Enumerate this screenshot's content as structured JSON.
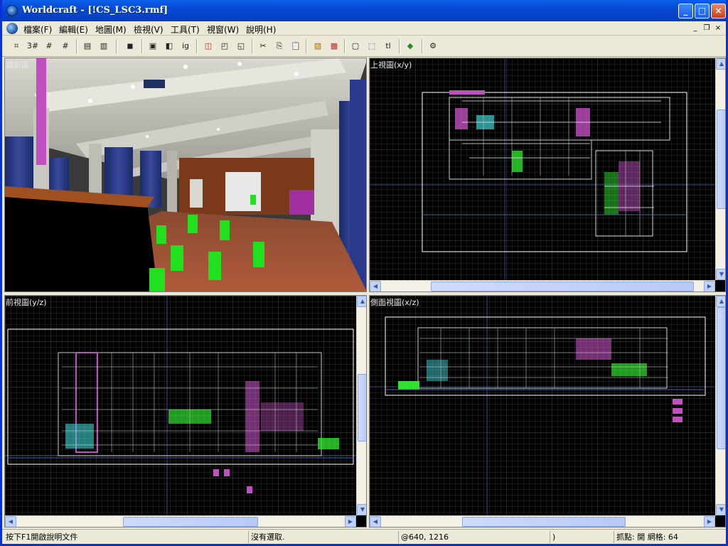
{
  "app": {
    "title": "Worldcraft - [!CS_LSC3.rmf]"
  },
  "window_buttons": {
    "minimize": "_",
    "maximize": "□",
    "close": "×"
  },
  "menu": {
    "items": [
      {
        "label": "檔案(F)"
      },
      {
        "label": "編輯(E)"
      },
      {
        "label": "地圖(M)"
      },
      {
        "label": "檢視(V)"
      },
      {
        "label": "工具(T)"
      },
      {
        "label": "視窗(W)"
      },
      {
        "label": "說明(H)"
      }
    ],
    "mdi_minimize": "_",
    "mdi_restore": "❐",
    "mdi_close": "×"
  },
  "toolbar": {
    "buttons": [
      {
        "icon": "grid-toggle-icon",
        "glyph": "⌗"
      },
      {
        "icon": "grid-3d-icon",
        "glyph": "3#"
      },
      {
        "icon": "grid-smaller-icon",
        "glyph": "#"
      },
      {
        "icon": "grid-larger-icon",
        "glyph": "#"
      },
      {
        "icon": "group-icon",
        "glyph": "▤"
      },
      {
        "icon": "ungroup-icon",
        "glyph": "▥"
      },
      {
        "icon": "cube-icon",
        "glyph": "◼"
      },
      {
        "icon": "texture-lock-icon",
        "glyph": "▣"
      },
      {
        "icon": "texture-apply-icon",
        "glyph": "◧"
      },
      {
        "icon": "ignore-groups-icon",
        "glyph": "ig"
      },
      {
        "icon": "hide-objects-icon",
        "glyph": "◫"
      },
      {
        "icon": "show-objects-icon",
        "glyph": "◰"
      },
      {
        "icon": "carve-icon",
        "glyph": "◱"
      },
      {
        "icon": "cut-icon",
        "glyph": "✂"
      },
      {
        "icon": "copy-icon",
        "glyph": "⎘"
      },
      {
        "icon": "paste-icon",
        "glyph": "📋"
      },
      {
        "icon": "hollow-icon",
        "glyph": "▨"
      },
      {
        "icon": "texture-tool-icon",
        "glyph": "▩"
      },
      {
        "icon": "selection-box-icon",
        "glyph": "▢"
      },
      {
        "icon": "select-icon",
        "glyph": "⬚"
      },
      {
        "icon": "tl-icon",
        "glyph": "tl"
      },
      {
        "icon": "clip-icon",
        "glyph": "◆"
      },
      {
        "icon": "run-map-icon",
        "glyph": "⚙"
      }
    ]
  },
  "viewports": {
    "camera": {
      "label": "攝影區"
    },
    "top": {
      "label": "上視圖(x/y)"
    },
    "front": {
      "label": "前視圖(y/z)"
    },
    "side": {
      "label": "側面視圖(x/z)"
    }
  },
  "scroll": {
    "up": "▲",
    "down": "▼",
    "left": "◀",
    "right": "▶",
    "grip": "≡"
  },
  "status": {
    "help": "按下F1開啟說明文件",
    "selection": "沒有選取.",
    "coords": "@640, 1216",
    "size": ")",
    "snap": "抓點: 開 網格: 64"
  },
  "colors": {
    "title_blue": "#0a5fe8",
    "grid_line": "#3a3a3a",
    "grid_major": "#5a5a5a",
    "brush_white": "#ffffff",
    "brush_magenta": "#d060d0",
    "brush_green": "#30e030",
    "brush_cyan": "#40d0d0",
    "axis_blue": "#3050a0"
  }
}
